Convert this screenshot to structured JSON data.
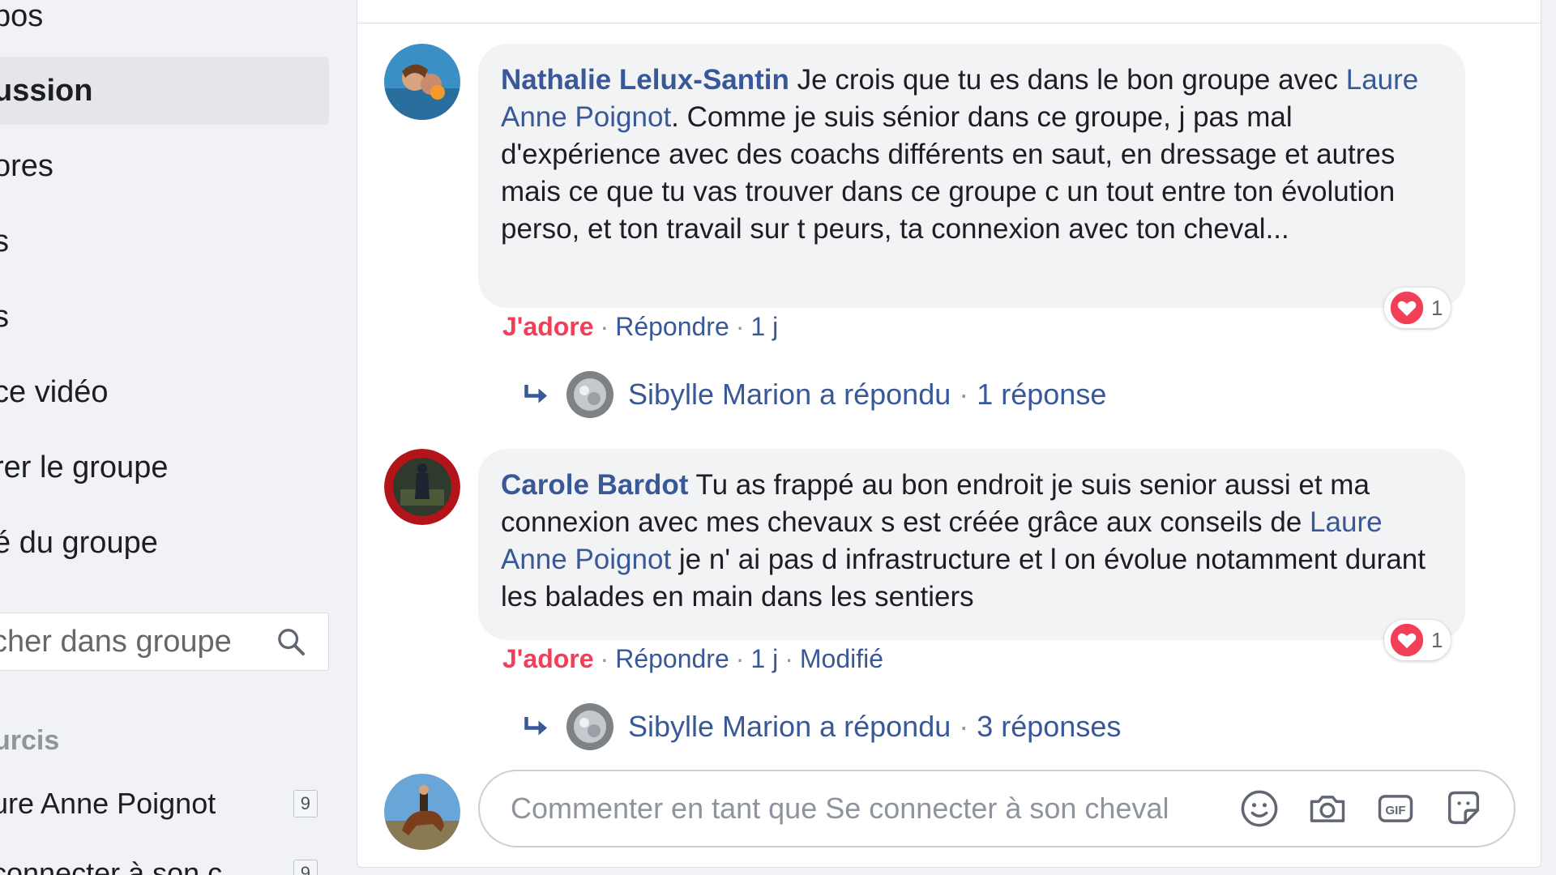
{
  "sidebar": {
    "nav": [
      {
        "label": "pos"
      },
      {
        "label": "ussion"
      },
      {
        "label": "ores"
      },
      {
        "label": "s"
      },
      {
        "label": "s"
      },
      {
        "label": "ce vidéo"
      },
      {
        "label": "rer le groupe"
      },
      {
        "label": "é du groupe"
      }
    ],
    "search_placeholder": "cher dans groupe",
    "shortcuts_title": "urcis",
    "shortcuts": [
      {
        "label": "ure Anne Poignot",
        "badge": "9"
      },
      {
        "label": "connecter à son c",
        "badge": "9"
      }
    ]
  },
  "comments": [
    {
      "author": "Nathalie Lelux-Santin",
      "text_part1": " Je crois que tu es dans le bon groupe avec ",
      "mention": "Laure Anne Poignot",
      "text_part2": ". Comme je suis sénior dans ce groupe, j pas mal d'expérience avec des coachs différents en saut, en dressage et autres mais ce que tu vas trouver dans ce groupe c un tout entre ton évolution perso, et ton travail sur t peurs, ta connexion avec ton cheval...",
      "reaction_count": "1",
      "like_label": "J'adore",
      "reply_label": "Répondre",
      "time": "1 j",
      "edited": "",
      "reply_summary": {
        "who": "Sibylle Marion a répondu",
        "count": "1 réponse"
      }
    },
    {
      "author": "Carole Bardot",
      "text_part1": " Tu as frappé au bon endroit je suis senior aussi et ma connexion avec mes chevaux s est créée grâce aux conseils de ",
      "mention": "Laure Anne Poignot",
      "text_part2": " je n' ai pas d infrastructure et l on évolue notamment durant les balades en main dans les sentiers",
      "reaction_count": "1",
      "like_label": "J'adore",
      "reply_label": "Répondre",
      "time": "1 j",
      "edited": "Modifié",
      "reply_summary": {
        "who": "Sibylle Marion a répondu",
        "count": "3 réponses"
      }
    }
  ],
  "composer": {
    "placeholder": "Commenter en tant que Se connecter à son cheval",
    "icons": [
      "emoji-icon",
      "camera-icon",
      "gif-icon",
      "sticker-icon"
    ]
  },
  "colors": {
    "link": "#385898",
    "like": "#f33e58",
    "bubble": "#f2f3f5"
  }
}
